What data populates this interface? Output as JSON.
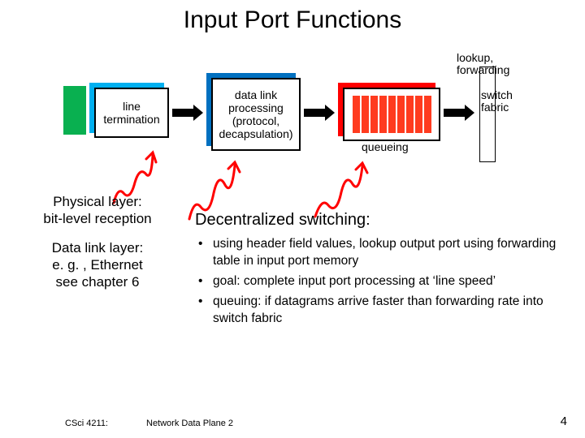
{
  "title": "Input Port Functions",
  "diagram": {
    "box1": "line\ntermination",
    "box2": "data link\nprocessing\n(protocol,\ndecapsulation)",
    "lookup_label": "lookup,\nforwarding",
    "queue_label": "queueing",
    "switch_label": "switch\nfabric"
  },
  "left": {
    "phys1": "Physical layer:",
    "phys2": "bit-level reception",
    "dl1": "Data link layer:",
    "dl2": "e. g. , Ethernet",
    "dl3": "see chapter 6"
  },
  "right": {
    "heading": "Decentralized switching:",
    "b1": "using header field values, lookup output port using forwarding table in input port memory",
    "b2": "goal: complete input port processing at ‘line speed’",
    "b3": "queuing: if datagrams arrive faster than forwarding rate into switch fabric"
  },
  "footer": {
    "course": "CSci 4211:",
    "mid": "Network Data Plane 2",
    "page": "4"
  }
}
